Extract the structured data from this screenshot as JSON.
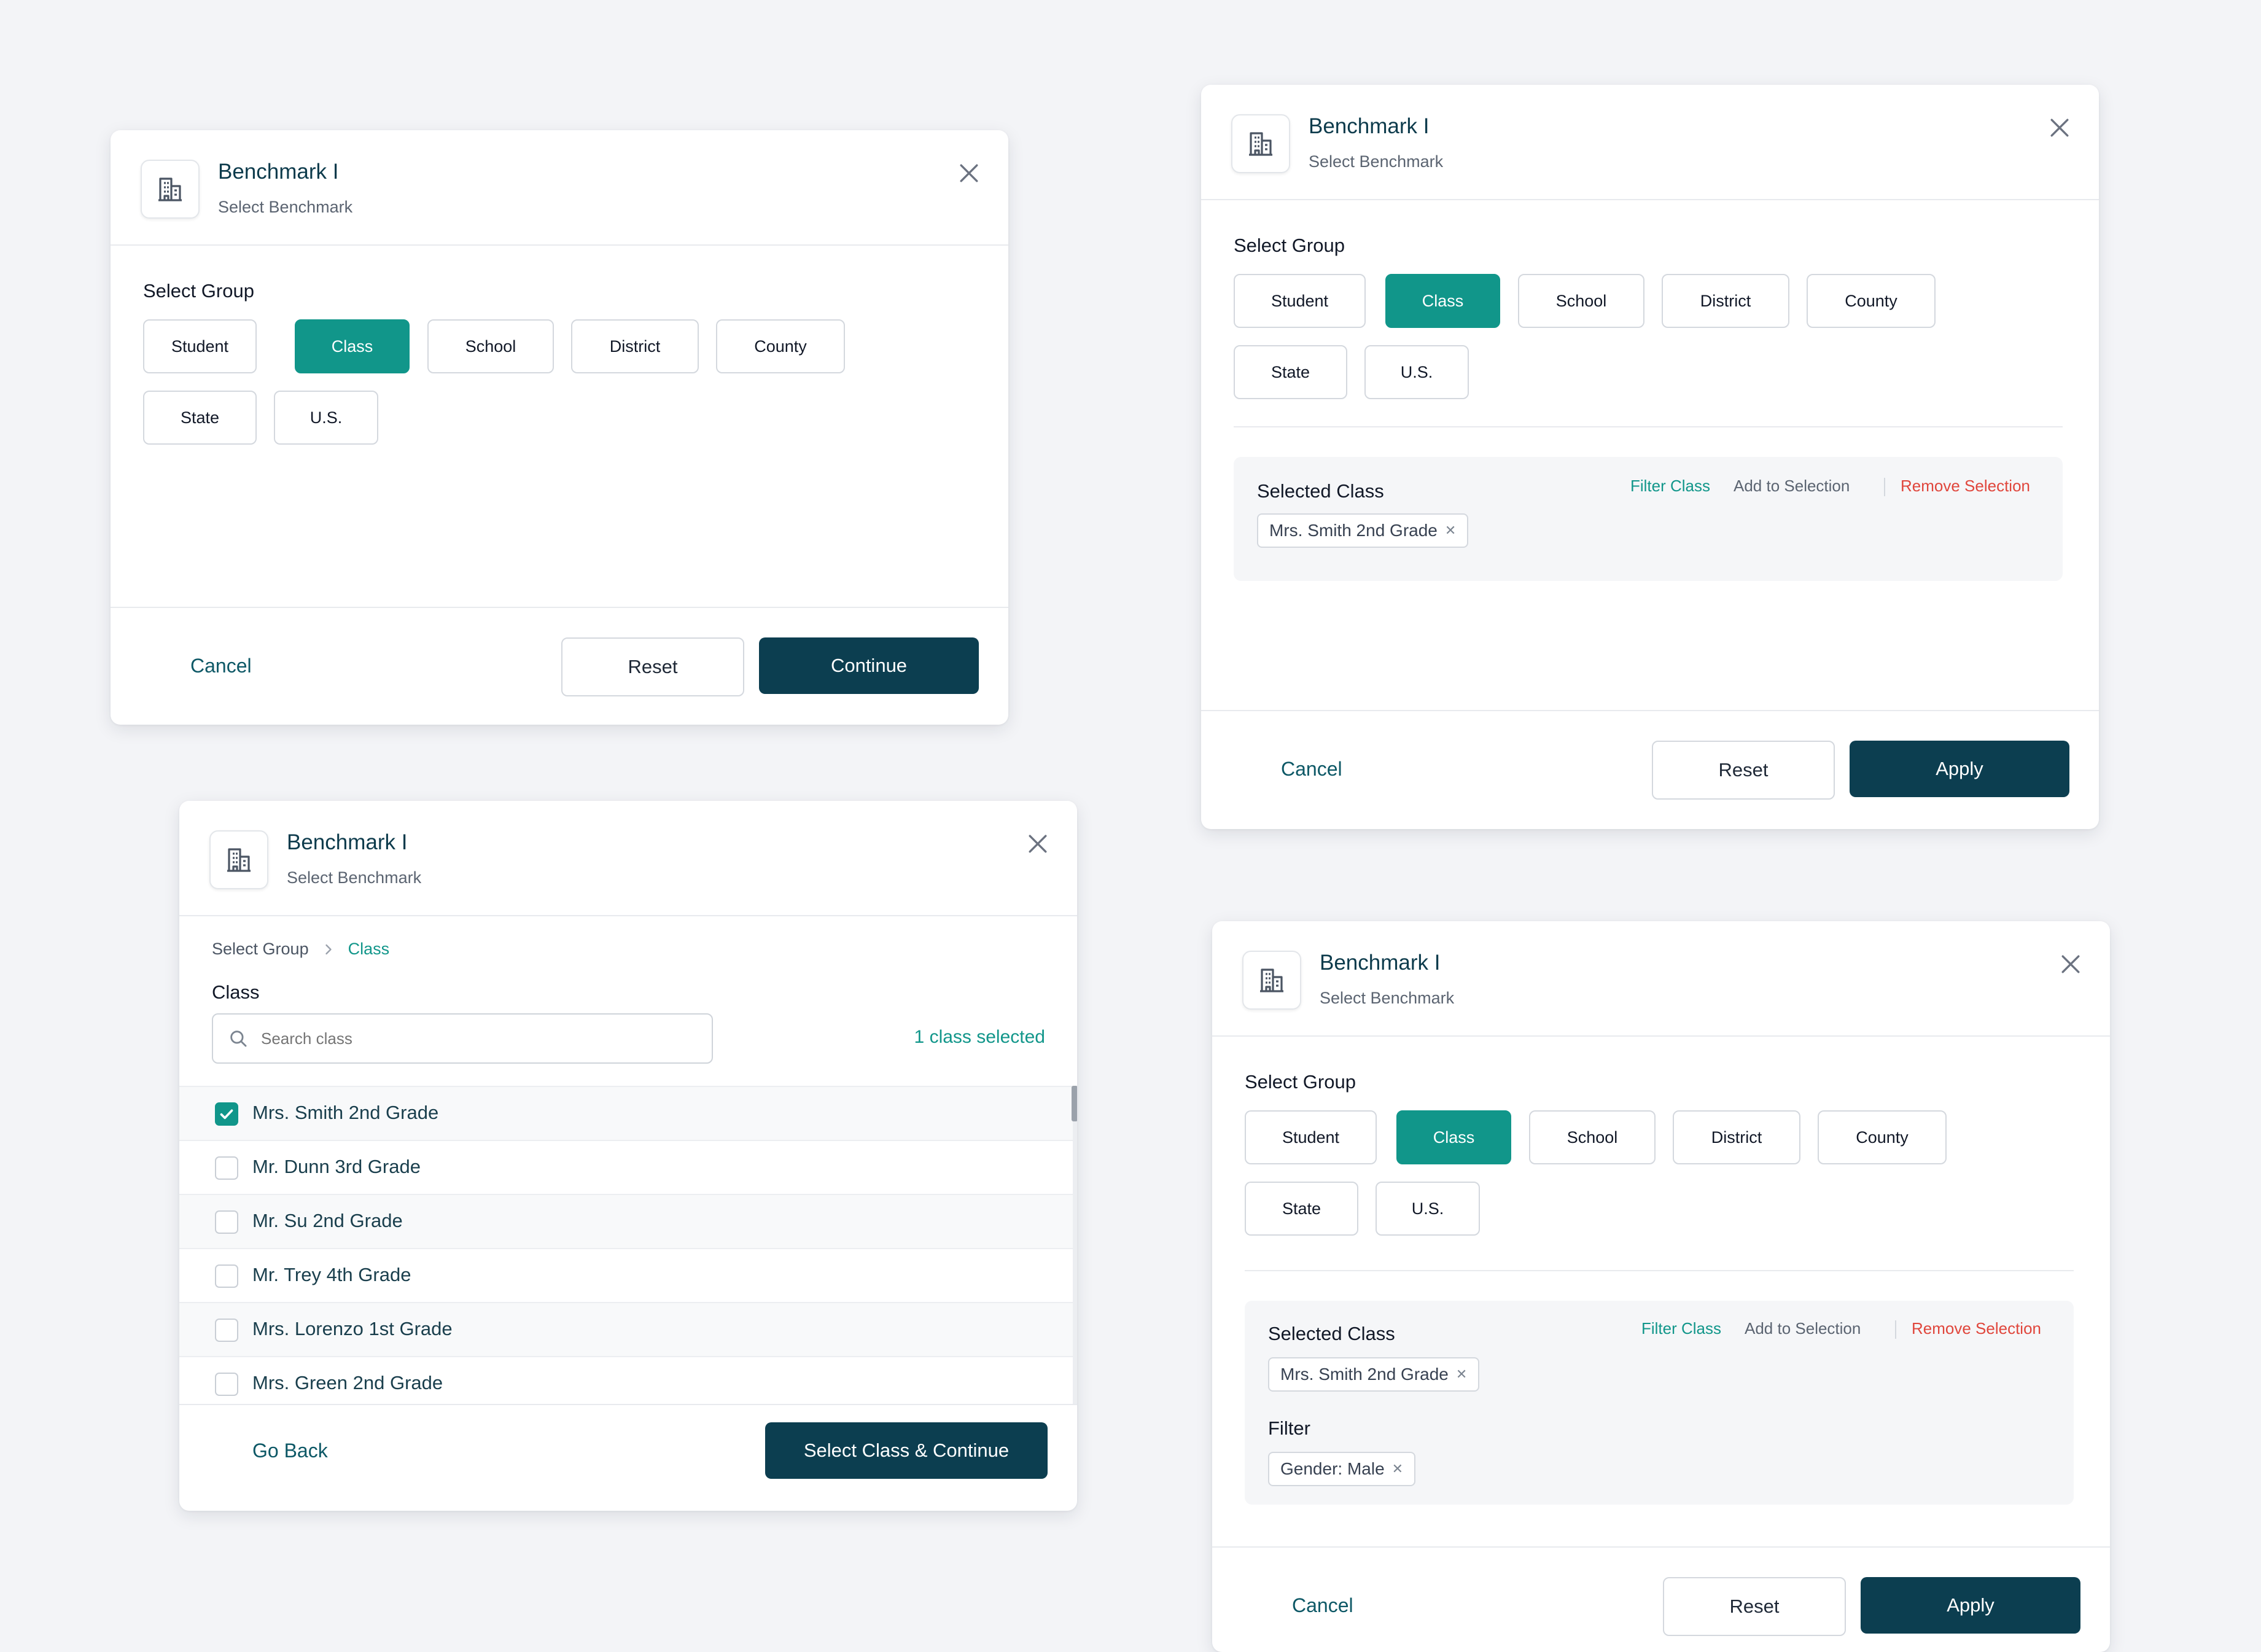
{
  "colors": {
    "background": "#f3f4f7",
    "accent_teal": "#11968a",
    "primary_navy": "#0c3e50",
    "danger_red": "#e0463c",
    "title_text": "#0d3b4c"
  },
  "icons": {
    "header": "building-icon",
    "close": "close-icon",
    "search": "search-icon",
    "breadcrumb_separator": "chevron-right-icon",
    "check": "check-icon",
    "tag_remove": "remove-x-icon"
  },
  "dialog_a": {
    "title": "Benchmark I",
    "subtitle": "Select Benchmark",
    "group_label": "Select Group",
    "groups": [
      "Student",
      "Class",
      "School",
      "District",
      "County",
      "State",
      "U.S."
    ],
    "selected_group": "Class",
    "footer": {
      "cancel": "Cancel",
      "reset": "Reset",
      "continue": "Continue"
    }
  },
  "dialog_b": {
    "title": "Benchmark I",
    "subtitle": "Select Benchmark",
    "group_label": "Select Group",
    "groups": [
      "Student",
      "Class",
      "School",
      "District",
      "County",
      "State",
      "U.S."
    ],
    "selected_group": "Class",
    "selected": {
      "heading": "Selected Class",
      "filter_link": "Filter Class",
      "add_link": "Add to Selection",
      "remove_link": "Remove Selection",
      "tags": [
        "Mrs. Smith 2nd Grade"
      ]
    },
    "footer": {
      "cancel": "Cancel",
      "reset": "Reset",
      "apply": "Apply"
    }
  },
  "dialog_c": {
    "title": "Benchmark I",
    "subtitle": "Select Benchmark",
    "breadcrumb": {
      "root": "Select Group",
      "current": "Class"
    },
    "field_label": "Class",
    "search": {
      "placeholder": "Search class",
      "value": ""
    },
    "selected_count": "1 class selected",
    "classes": [
      {
        "name": "Mrs. Smith 2nd Grade",
        "checked": true
      },
      {
        "name": "Mr. Dunn 3rd Grade",
        "checked": false
      },
      {
        "name": "Mr. Su 2nd Grade",
        "checked": false
      },
      {
        "name": "Mr. Trey 4th Grade",
        "checked": false
      },
      {
        "name": "Mrs. Lorenzo 1st Grade",
        "checked": false
      },
      {
        "name": "Mrs. Green 2nd Grade",
        "checked": false
      }
    ],
    "footer": {
      "back": "Go Back",
      "continue": "Select Class & Continue"
    }
  },
  "dialog_d": {
    "title": "Benchmark I",
    "subtitle": "Select Benchmark",
    "group_label": "Select Group",
    "groups": [
      "Student",
      "Class",
      "School",
      "District",
      "County",
      "State",
      "U.S."
    ],
    "selected_group": "Class",
    "selected": {
      "heading": "Selected Class",
      "filter_link": "Filter Class",
      "add_link": "Add to Selection",
      "remove_link": "Remove Selection",
      "tags": [
        "Mrs. Smith 2nd Grade"
      ],
      "filter_heading": "Filter",
      "filter_tags": [
        "Gender: Male"
      ]
    },
    "footer": {
      "cancel": "Cancel",
      "reset": "Reset",
      "apply": "Apply"
    }
  }
}
